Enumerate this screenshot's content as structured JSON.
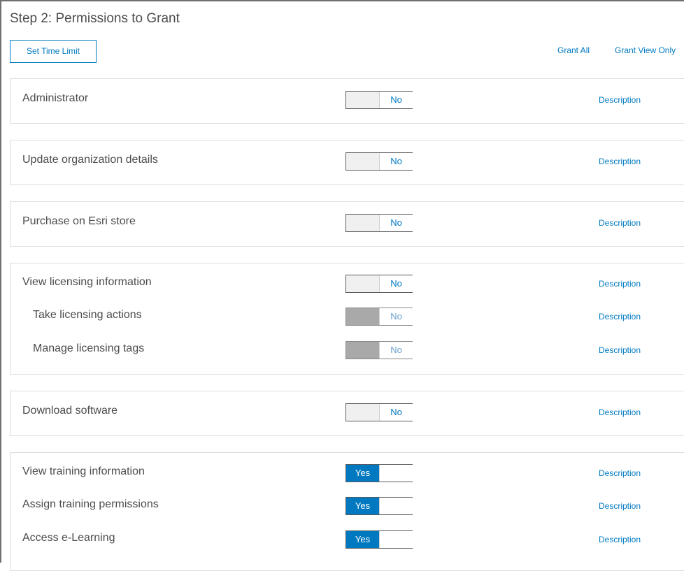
{
  "header": {
    "title": "Step 2: Permissions to Grant",
    "set_time_limit": "Set Time Limit",
    "grant_all": "Grant All",
    "grant_view_only": "Grant View Only"
  },
  "colors": {
    "accent": "#0079c1",
    "disabled_toggle": "#a9a9a9"
  },
  "permissions": {
    "administrator": {
      "label": "Administrator",
      "value": "No",
      "description": "Description"
    },
    "update_org": {
      "label": "Update organization details",
      "value": "No",
      "description": "Description"
    },
    "purchase": {
      "label": "Purchase on Esri store",
      "value": "No",
      "description": "Description"
    },
    "view_licensing": {
      "label": "View licensing information",
      "value": "No",
      "description": "Description"
    },
    "take_licensing": {
      "label": "Take licensing actions",
      "value": "No",
      "description": "Description"
    },
    "manage_tags": {
      "label": "Manage licensing tags",
      "value": "No",
      "description": "Description"
    },
    "download": {
      "label": "Download software",
      "value": "No",
      "description": "Description"
    },
    "view_training": {
      "label": "View training information",
      "value": "Yes",
      "description": "Description"
    },
    "assign_training": {
      "label": "Assign training permissions",
      "value": "Yes",
      "description": "Description"
    },
    "elearning": {
      "label": "Access e-Learning",
      "value": "Yes",
      "description": "Description"
    }
  }
}
